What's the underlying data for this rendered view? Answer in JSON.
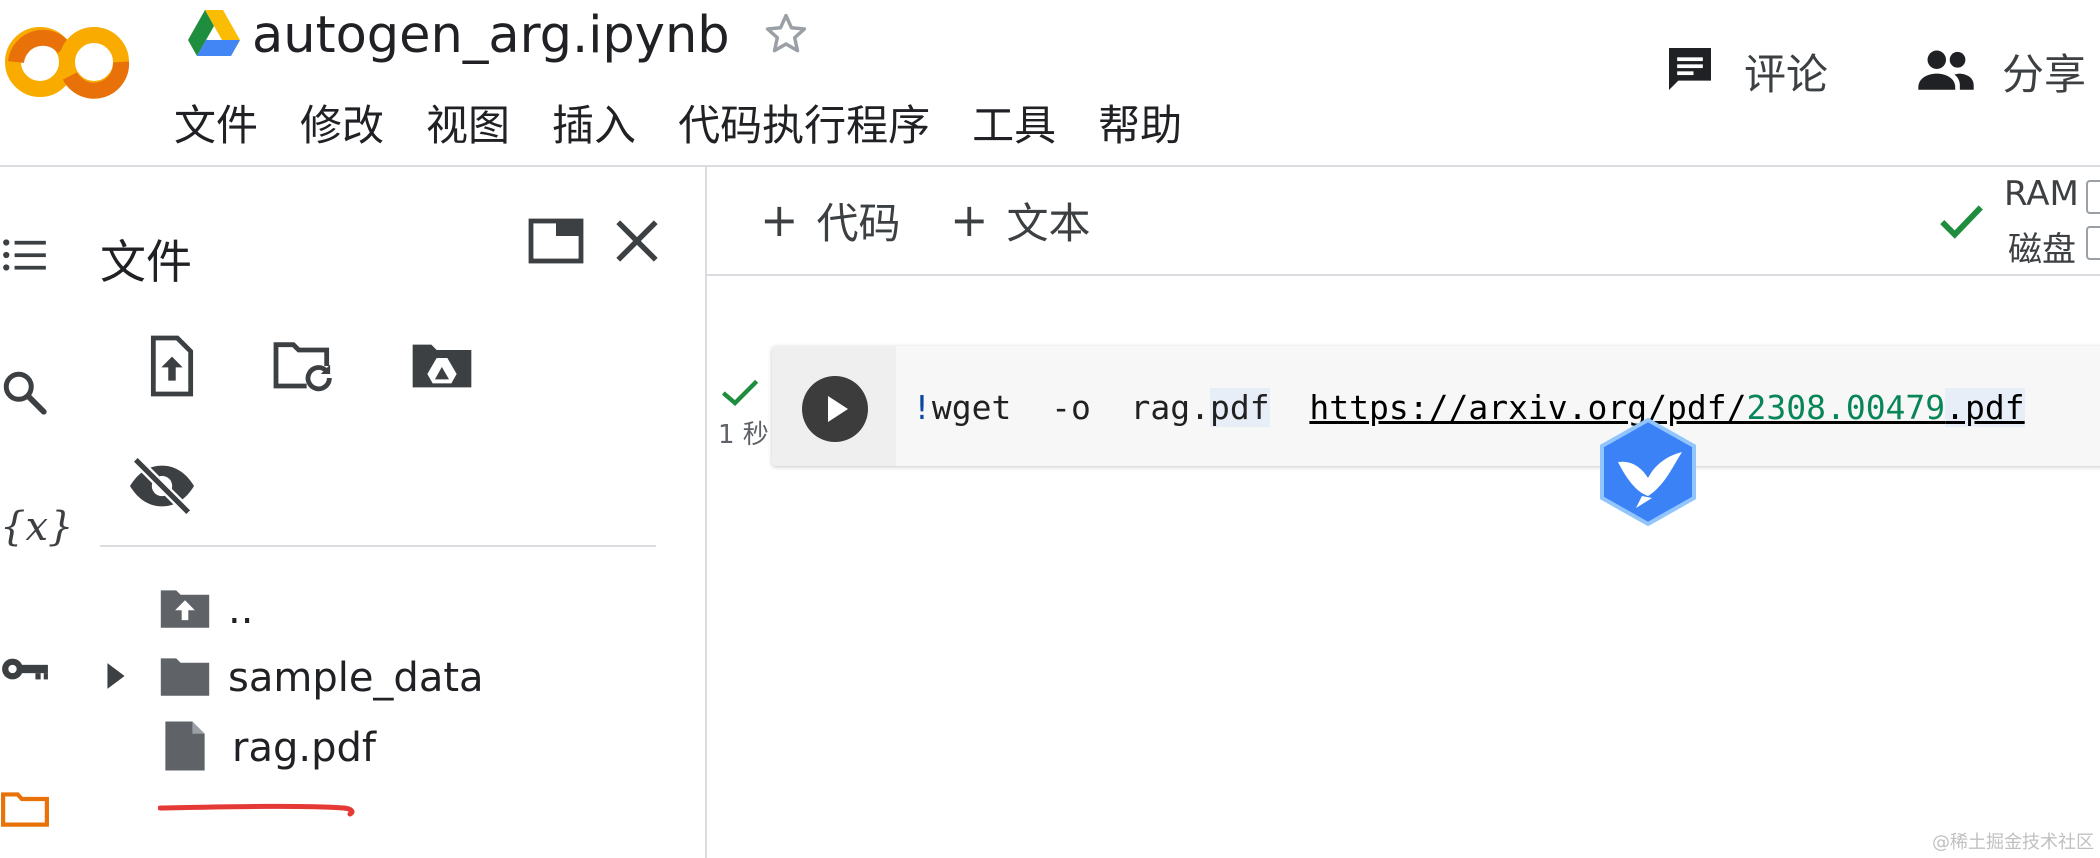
{
  "header": {
    "app_logo": "colab-logo",
    "notebook_title": "autogen_arg.ipynb",
    "star_icon": "star-outline-icon",
    "comments_label": "评论",
    "share_label": "分享"
  },
  "menubar": {
    "items": [
      "文件",
      "修改",
      "视图",
      "插入",
      "代码执行程序",
      "工具",
      "帮助"
    ]
  },
  "left_rail": {
    "icons": [
      "table-of-contents-icon",
      "search-icon",
      "variables-icon",
      "key-icon",
      "folder-icon"
    ]
  },
  "files_panel": {
    "title": "文件",
    "toolbar_icons": [
      "upload-file-icon",
      "refresh-folder-icon",
      "mount-drive-icon",
      "hide-files-icon"
    ],
    "tree": [
      {
        "label": "..",
        "icon": "parent-folder-icon",
        "expandable": false
      },
      {
        "label": "sample_data",
        "icon": "folder-icon",
        "expandable": true
      },
      {
        "label": "rag.pdf",
        "icon": "file-icon",
        "expandable": false
      }
    ]
  },
  "notebook": {
    "toolbar": {
      "add_code_label": "代码",
      "add_text_label": "文本",
      "ram_label": "RAM",
      "disk_label": "磁盘"
    },
    "cell": {
      "exec_time": "1 秒",
      "code_bang": "!",
      "code_cmd": "wget  -o  rag.",
      "code_pdf": "pdf",
      "code_url_a": "https://arxiv.org/pdf/",
      "code_url_num": "2308.00479",
      "code_url_ext": ".pdf"
    }
  },
  "colors": {
    "success_green": "#1e8e3e",
    "logo_orange": "#f9ab00",
    "logo_dark_orange": "#e8710a",
    "annotation_red": "#e53935",
    "badge_blue": "#3b82f6"
  },
  "watermark": "@稀土掘金技术社区"
}
